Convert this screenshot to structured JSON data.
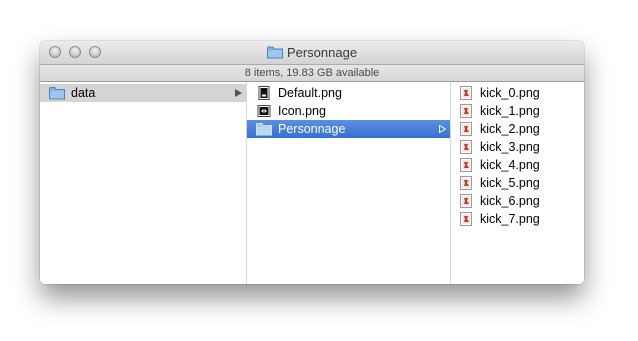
{
  "window": {
    "title": "Personnage",
    "title_icon": "folder-icon"
  },
  "status": {
    "text": "8 items, 19.83 GB available"
  },
  "columns": {
    "first": {
      "items": [
        {
          "label": "data",
          "icon": "folder-icon",
          "state": "parent-selected"
        }
      ]
    },
    "second": {
      "items": [
        {
          "label": "Default.png",
          "icon": "png-file-icon"
        },
        {
          "label": "Icon.png",
          "icon": "png-file-icon"
        },
        {
          "label": "Personnage",
          "icon": "folder-icon",
          "state": "selected"
        }
      ]
    },
    "third": {
      "items": [
        {
          "label": "kick_0.png",
          "icon": "image-file-icon"
        },
        {
          "label": "kick_1.png",
          "icon": "image-file-icon"
        },
        {
          "label": "kick_2.png",
          "icon": "image-file-icon"
        },
        {
          "label": "kick_3.png",
          "icon": "image-file-icon"
        },
        {
          "label": "kick_4.png",
          "icon": "image-file-icon"
        },
        {
          "label": "kick_5.png",
          "icon": "image-file-icon"
        },
        {
          "label": "kick_6.png",
          "icon": "image-file-icon"
        },
        {
          "label": "kick_7.png",
          "icon": "image-file-icon"
        }
      ]
    }
  },
  "colors": {
    "selection": "#3470d4",
    "parent_selection": "#d4d4d4",
    "folder": "#7db1e4"
  }
}
